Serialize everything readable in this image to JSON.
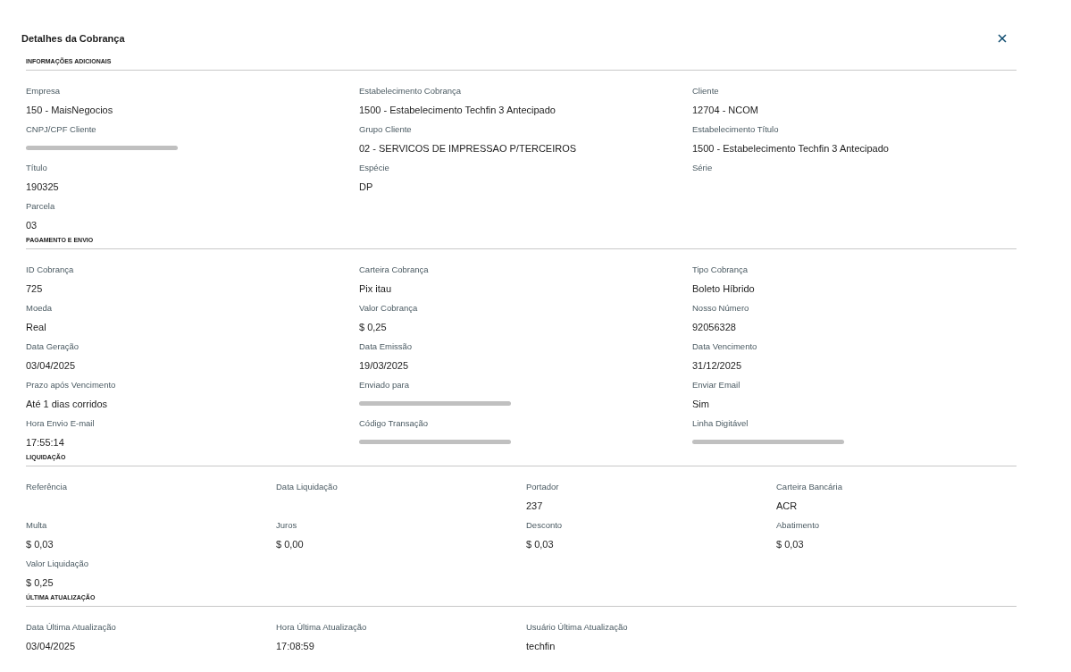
{
  "title": "Detalhes da Cobrança",
  "sections": [
    {
      "title": "INFORMAÇÕES ADICIONAIS",
      "kind": "three-column",
      "fields": [
        {
          "label": "Empresa",
          "value": "150 - MaisNegocios"
        },
        {
          "label": "Estabelecimento Cobrança",
          "value": "1500 - Estabelecimento Techfin 3 Antecipado"
        },
        {
          "label": "Cliente",
          "value": "12704 - NCOM"
        },
        {
          "label": "CNPJ/CPF Cliente",
          "redacted": true
        },
        {
          "label": "Grupo Cliente",
          "value": "02 - SERVICOS DE IMPRESSAO P/TERCEIROS"
        },
        {
          "label": "Estabelecimento Título",
          "value": "1500 - Estabelecimento Techfin 3 Antecipado"
        },
        {
          "label": "Título",
          "value": "190325"
        },
        {
          "label": "Espécie",
          "value": "DP"
        },
        {
          "label": "Série"
        },
        {
          "label": "Parcela",
          "value": "03"
        }
      ]
    },
    {
      "title": "PAGAMENTO E ENVIO",
      "kind": "three-column",
      "fields": [
        {
          "label": "ID Cobrança",
          "value": "725"
        },
        {
          "label": "Carteira Cobrança",
          "value": "Pix itau"
        },
        {
          "label": "Tipo Cobrança",
          "value": "Boleto Híbrido"
        },
        {
          "label": "Moeda",
          "value": "Real"
        },
        {
          "label": "Valor Cobrança",
          "value": "$ 0,25"
        },
        {
          "label": "Nosso Número",
          "value": "92056328"
        },
        {
          "label": "Data Geração",
          "value": "03/04/2025"
        },
        {
          "label": "Data Emissão",
          "value": "19/03/2025"
        },
        {
          "label": "Data Vencimento",
          "value": "31/12/2025"
        },
        {
          "label": "Prazo após Vencimento",
          "value": "Até 1 dias corridos"
        },
        {
          "label": "Enviado para",
          "redacted": true
        },
        {
          "label": "Enviar Email",
          "value": "Sim"
        },
        {
          "label": "Hora Envio E-mail",
          "value": "17:55:14"
        },
        {
          "label": "Código Transação",
          "redacted": true
        },
        {
          "label": "Linha Digitável",
          "redacted": true
        }
      ]
    },
    {
      "title": "LIQUIDAÇÃO",
      "kind": "four-column",
      "fields": [
        {
          "label": "Referência"
        },
        {
          "label": "Data Liquidação"
        },
        {
          "label": "Portador",
          "value": "237"
        },
        {
          "label": "Carteira Bancária",
          "value": "ACR"
        },
        {
          "label": "Multa",
          "value": "$ 0,03"
        },
        {
          "label": "Juros",
          "value": "$ 0,00"
        },
        {
          "label": "Desconto",
          "value": "$ 0,03"
        },
        {
          "label": "Abatimento",
          "value": "$ 0,03"
        },
        {
          "label": "Valor Liquidação",
          "value": "$ 0,25"
        }
      ]
    },
    {
      "title": "ÚLTIMA ATUALIZAÇÃO",
      "kind": "four-column",
      "fields": [
        {
          "label": "Data Última Atualização",
          "value": "03/04/2025"
        },
        {
          "label": "Hora Última Atualização",
          "value": "17:08:59"
        },
        {
          "label": "Usuário Última Atualização",
          "value": "techfin"
        }
      ]
    }
  ]
}
